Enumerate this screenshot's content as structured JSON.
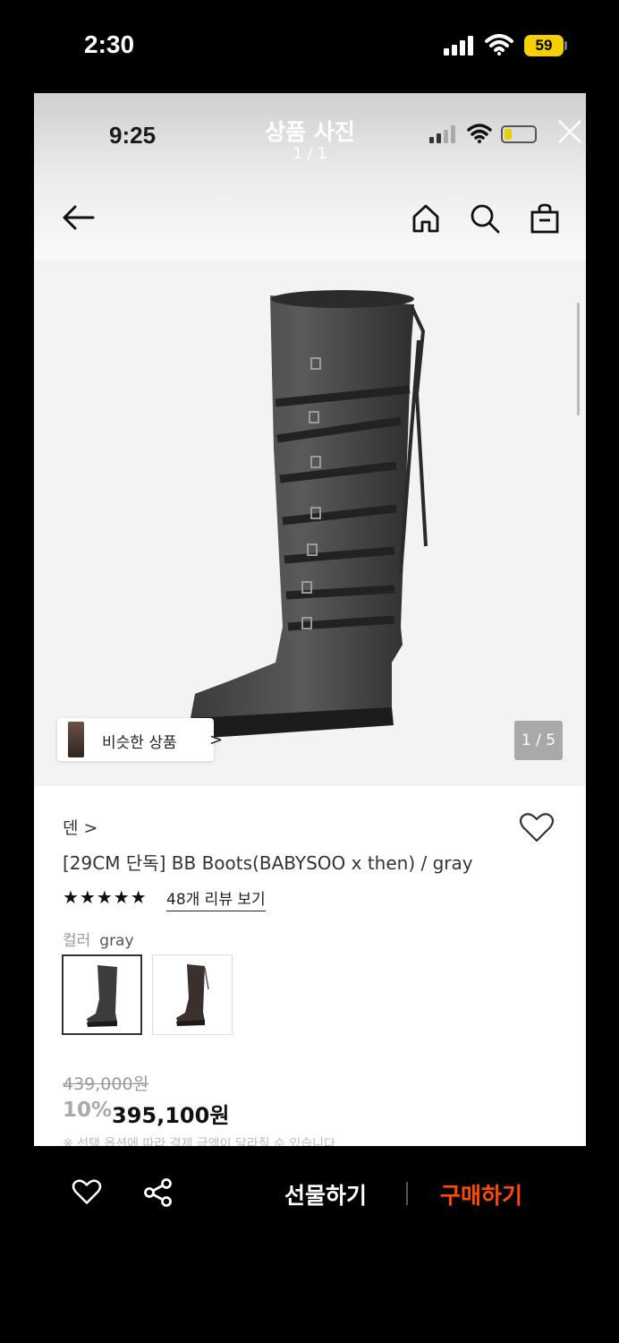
{
  "outer_status": {
    "time": "2:30",
    "battery": "59"
  },
  "inner_status": {
    "time": "9:25"
  },
  "photo_viewer": {
    "title": "상품 사진",
    "count": "1 / 1"
  },
  "nav": {
    "icons": [
      "arrow-left-icon",
      "home-icon",
      "search-icon",
      "shopping-bag-icon"
    ]
  },
  "gallery": {
    "similar_label": "비슷한 상품",
    "similar_chevron": ">",
    "pager": "1 / 5"
  },
  "product": {
    "brand": "덴 >",
    "name": "[29CM 단독] BB Boots(BABYSOO x then) / gray",
    "stars": "★★★★★",
    "rating": 5,
    "review_link": "48개 리뷰 보기",
    "color_key": "컬러",
    "color_value": "gray",
    "original_price": "439,000원",
    "discount": "10%",
    "sale_price": "395,100원",
    "note": "※ 선택 옵션에 따라 결제 금액이 달라질 수 있습니다."
  },
  "bottom_bar": {
    "gift_label": "선물하기",
    "buy_label": "구매하기"
  },
  "colors": {
    "buy_accent": "#ff4800",
    "battery_yellow": "#f5d000"
  }
}
